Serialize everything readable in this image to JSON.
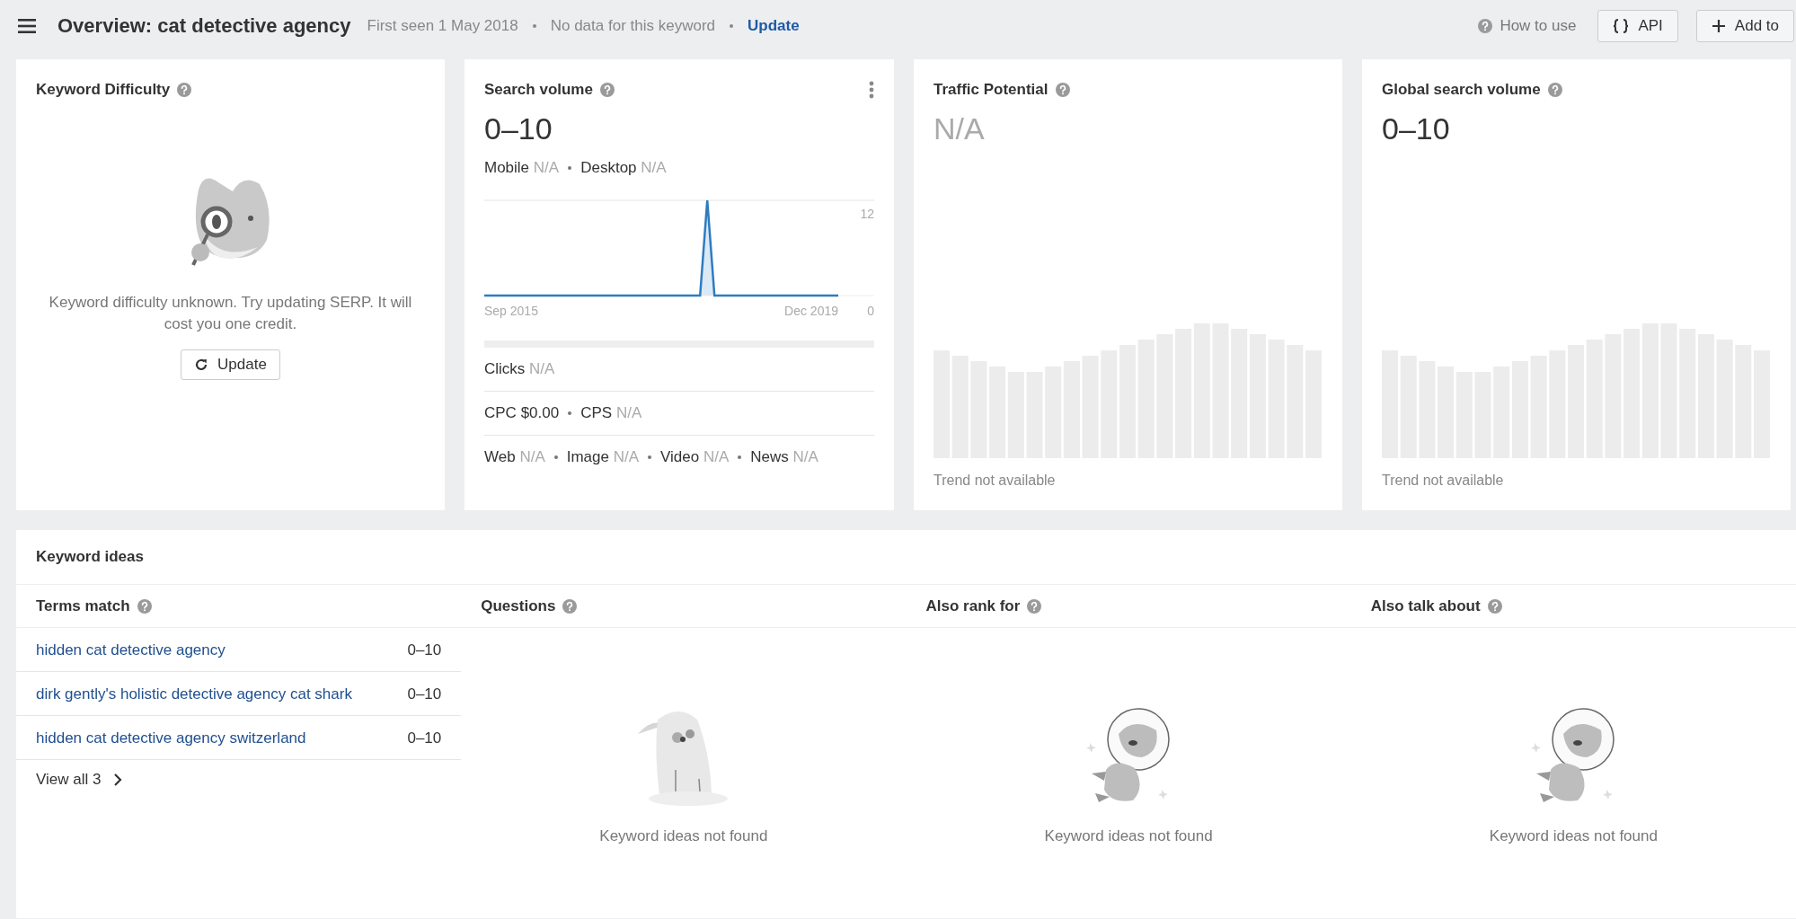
{
  "header": {
    "title": "Overview: cat detective agency",
    "meta": [
      "First seen 1 May 2018",
      "No data for this keyword"
    ],
    "update_link": "Update",
    "help_link": "How to use",
    "buttons": [
      {
        "kind": "api",
        "label": "API"
      },
      {
        "kind": "add",
        "label": "Add to"
      }
    ]
  },
  "cards": [
    {
      "kind": "difficulty",
      "title": "Keyword Difficulty",
      "message": "Keyword difficulty unknown. Try updating SERP. It will cost you one credit.",
      "button": "Update"
    },
    {
      "kind": "volume",
      "title": "Search volume",
      "value": "0–10",
      "value_muted": false,
      "split": [
        {
          "label": "Mobile",
          "value": "N/A",
          "muted": true
        },
        {
          "label": "Desktop",
          "value": "N/A",
          "muted": true
        }
      ],
      "trend": {
        "x_labels": [
          "Sep 2015",
          "Dec 2019"
        ],
        "y_labels": [
          "12",
          "0"
        ]
      },
      "rows": [
        [
          {
            "label": "Clicks",
            "value": "N/A",
            "muted": true
          }
        ],
        [
          {
            "label": "CPC",
            "value": "$0.00",
            "muted": false
          },
          {
            "label": "CPS",
            "value": "N/A",
            "muted": true
          }
        ],
        [
          {
            "label": "Web",
            "value": "N/A",
            "muted": true
          },
          {
            "label": "Image",
            "value": "N/A",
            "muted": true
          },
          {
            "label": "Video",
            "value": "N/A",
            "muted": true
          },
          {
            "label": "News",
            "value": "N/A",
            "muted": true
          }
        ]
      ]
    },
    {
      "kind": "trend",
      "title": "Traffic Potential",
      "value": "N/A",
      "value_muted": true,
      "note": "Trend not available"
    },
    {
      "kind": "trend",
      "title": "Global search volume",
      "value": "0–10",
      "value_muted": false,
      "note": "Trend not available"
    }
  ],
  "ideas": {
    "title": "Keyword ideas",
    "columns": [
      {
        "kind": "list",
        "title": "Terms match",
        "items": [
          {
            "keyword": "hidden cat detective agency",
            "volume": "0–10"
          },
          {
            "keyword": "dirk gently's holistic detective agency cat shark",
            "volume": "0–10"
          },
          {
            "keyword": "hidden cat detective agency switzerland",
            "volume": "0–10"
          }
        ],
        "more": "View all 3"
      },
      {
        "kind": "empty",
        "title": "Questions",
        "message": "Keyword ideas not found"
      },
      {
        "kind": "empty",
        "title": "Also rank for",
        "message": "Keyword ideas not found"
      },
      {
        "kind": "empty",
        "title": "Also talk about",
        "message": "Keyword ideas not found"
      }
    ]
  }
}
